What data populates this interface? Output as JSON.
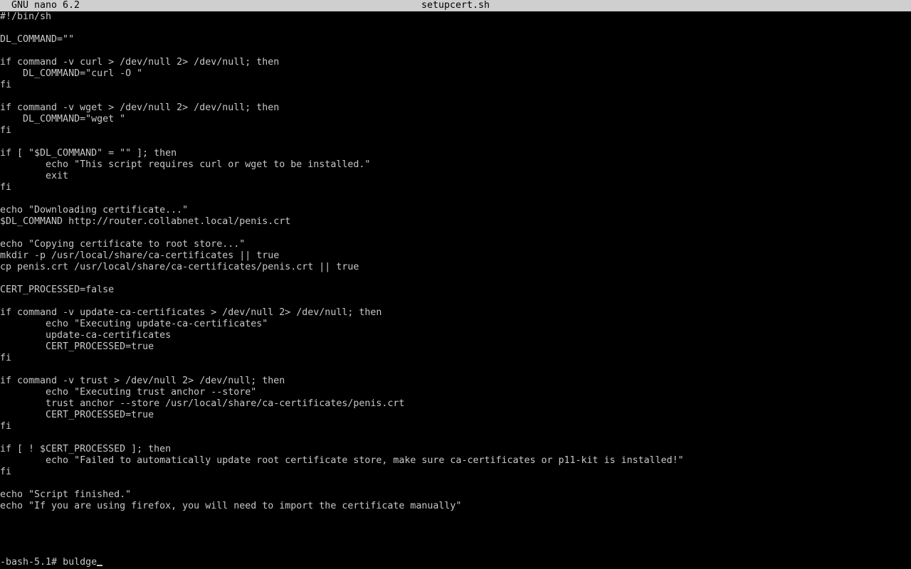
{
  "titlebar": {
    "app_version": "GNU nano 6.2",
    "filename": "setupcert.sh"
  },
  "editor": {
    "lines": [
      "#!/bin/sh",
      "",
      "DL_COMMAND=\"\"",
      "",
      "if command -v curl > /dev/null 2> /dev/null; then",
      "    DL_COMMAND=\"curl -O \"",
      "fi",
      "",
      "if command -v wget > /dev/null 2> /dev/null; then",
      "    DL_COMMAND=\"wget \"",
      "fi",
      "",
      "if [ \"$DL_COMMAND\" = \"\" ]; then",
      "        echo \"This script requires curl or wget to be installed.\"",
      "        exit",
      "fi",
      "",
      "echo \"Downloading certificate...\"",
      "$DL_COMMAND http://router.collabnet.local/penis.crt",
      "",
      "echo \"Copying certificate to root store...\"",
      "mkdir -p /usr/local/share/ca-certificates || true",
      "cp penis.crt /usr/local/share/ca-certificates/penis.crt || true",
      "",
      "CERT_PROCESSED=false",
      "",
      "if command -v update-ca-certificates > /dev/null 2> /dev/null; then",
      "        echo \"Executing update-ca-certificates\"",
      "        update-ca-certificates",
      "        CERT_PROCESSED=true",
      "fi",
      "",
      "if command -v trust > /dev/null 2> /dev/null; then",
      "        echo \"Executing trust anchor --store\"",
      "        trust anchor --store /usr/local/share/ca-certificates/penis.crt",
      "        CERT_PROCESSED=true",
      "fi",
      "",
      "if [ ! $CERT_PROCESSED ]; then",
      "        echo \"Failed to automatically update root certificate store, make sure ca-certificates or p11-kit is installed!\"",
      "fi",
      "",
      "echo \"Script finished.\"",
      "echo \"If you are using firefox, you will need to import the certificate manually\""
    ]
  },
  "shell": {
    "prompt": "-bash-5.1# ",
    "input": "buldge"
  }
}
